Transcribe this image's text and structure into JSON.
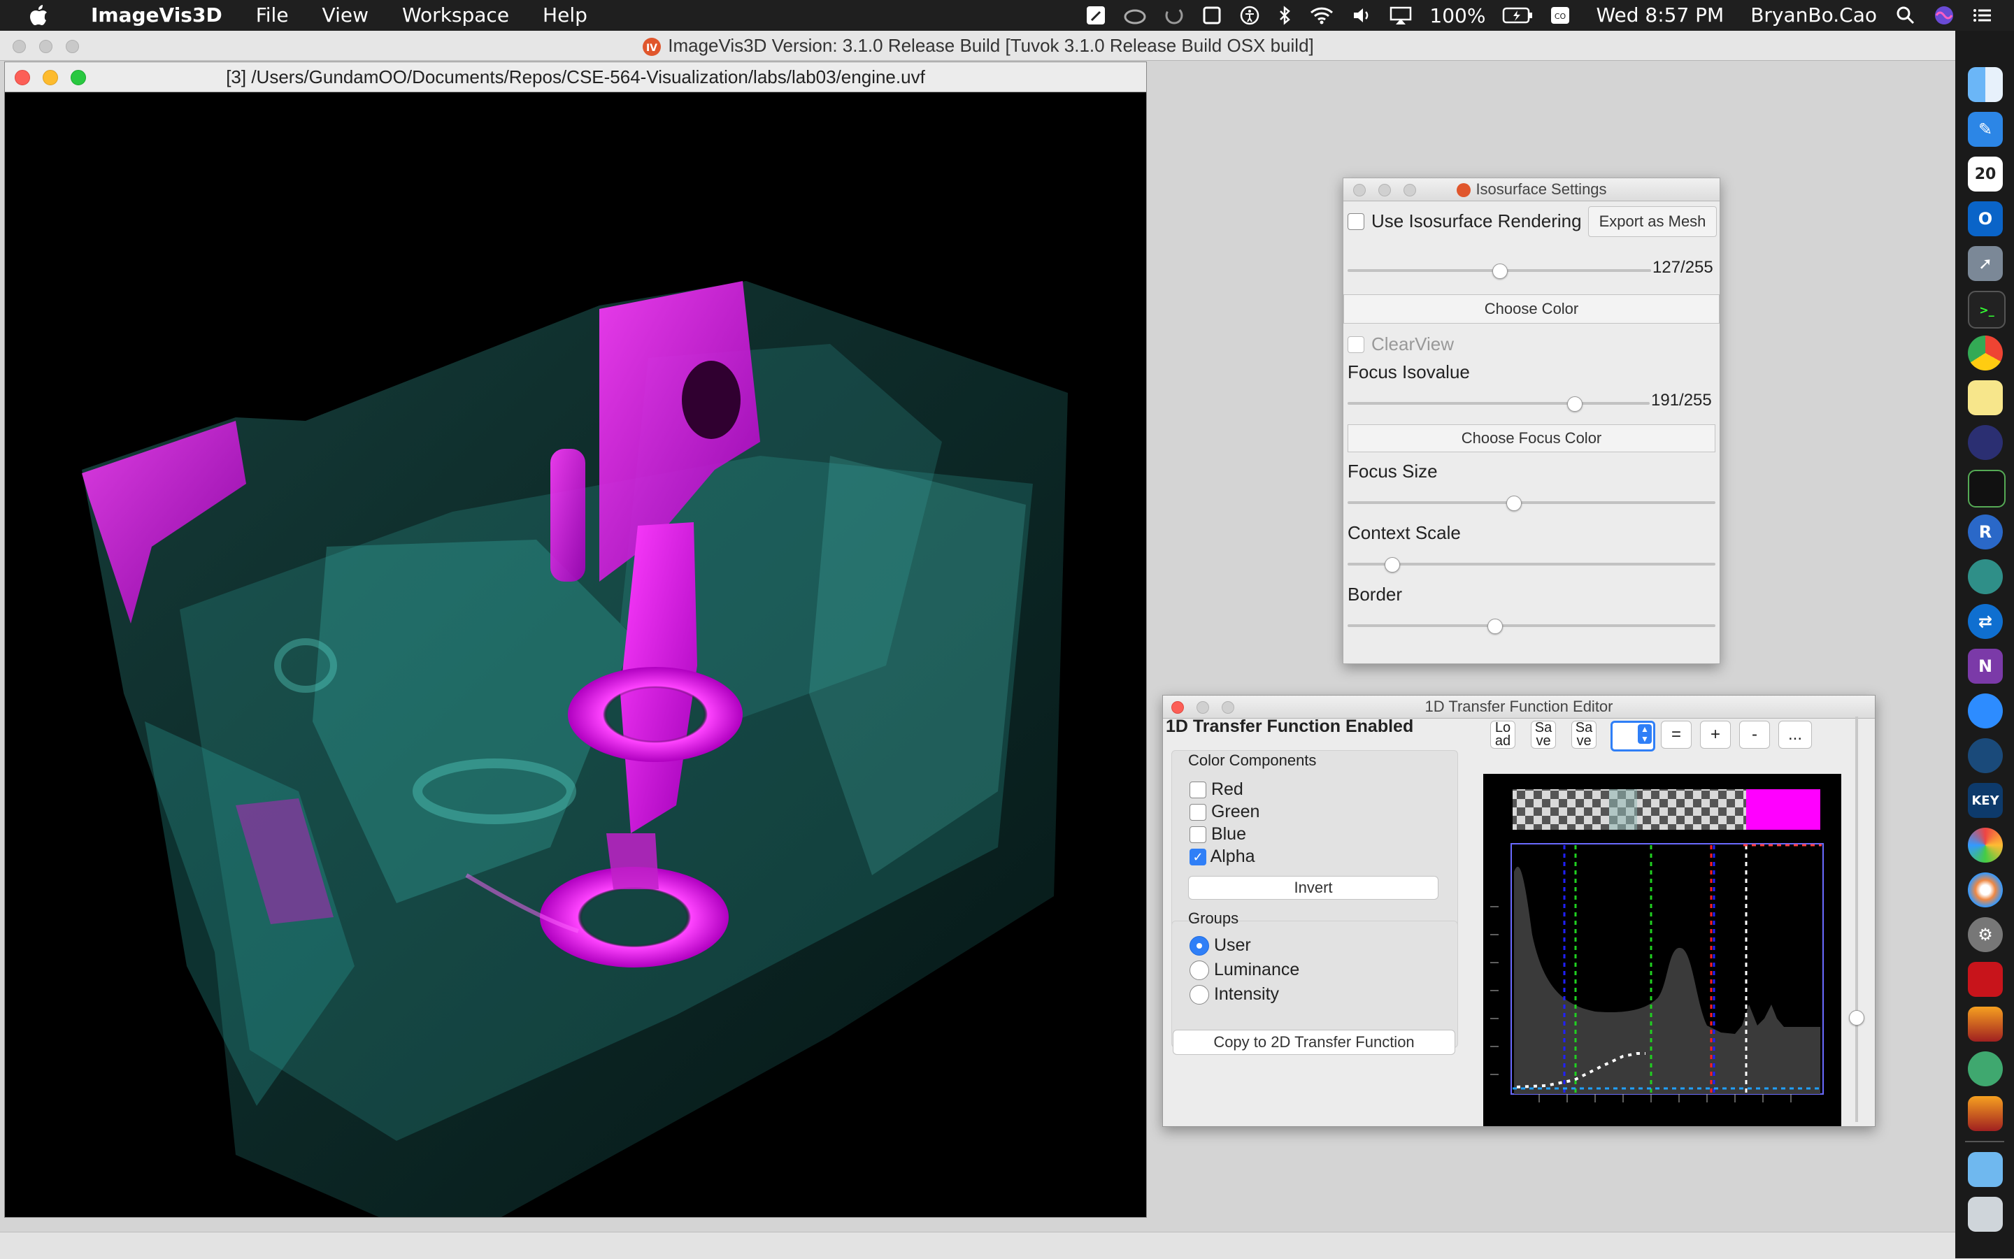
{
  "menubar": {
    "app_name": "ImageVis3D",
    "menus": [
      "File",
      "View",
      "Workspace",
      "Help"
    ],
    "battery": "100%",
    "clock": "Wed 8:57 PM",
    "user": "BryanBo.Cao"
  },
  "main_window": {
    "title": "ImageVis3D Version: 3.1.0 Release Build [Tuvok 3.1.0 Release Build OSX build]"
  },
  "render_window": {
    "title": "[3] /Users/GundamOO/Documents/Repos/CSE-564-Visualization/labs/lab03/engine.uvf"
  },
  "isosurface": {
    "title": "Isosurface Settings",
    "use_label": "Use Isosurface Rendering",
    "export_label": "Export as Mesh",
    "isovalue": "127/255",
    "isovalue_fraction": 0.5,
    "choose_color": "Choose Color",
    "clearview_label": "ClearView",
    "focus_isovalue_label": "Focus Isovalue",
    "focus_isovalue": "191/255",
    "focus_isovalue_fraction": 0.75,
    "choose_focus_color": "Choose Focus Color",
    "focus_size_label": "Focus Size",
    "focus_size_fraction": 0.45,
    "context_scale_label": "Context Scale",
    "context_scale_fraction": 0.12,
    "border_label": "Border",
    "border_fraction": 0.4
  },
  "tf_editor": {
    "title": "1D Transfer Function Editor",
    "status": "1D Transfer Function Enabled",
    "color_components_label": "Color Components",
    "components": [
      {
        "label": "Red",
        "checked": false
      },
      {
        "label": "Green",
        "checked": false
      },
      {
        "label": "Blue",
        "checked": false
      },
      {
        "label": "Alpha",
        "checked": true
      }
    ],
    "invert_label": "Invert",
    "groups_label": "Groups",
    "groups": [
      {
        "label": "User",
        "selected": true
      },
      {
        "label": "Luminance",
        "selected": false
      },
      {
        "label": "Intensity",
        "selected": false
      }
    ],
    "copy_label": "Copy to 2D Transfer Function",
    "toolbar": {
      "load": "Lo ad",
      "save1": "Sa ve",
      "save2": "Sa ve",
      "eq": "=",
      "plus": "+",
      "minus": "-",
      "more": "..."
    }
  },
  "colors": {
    "accent": "#2f7ff7",
    "magenta": "#ff00ff",
    "teal": "#3fb7b0"
  },
  "dock_icons": [
    "finder-icon",
    "pen-icon",
    "calendar-icon",
    "outlook-icon",
    "rocket-icon",
    "terminal-icon",
    "chrome-icon",
    "notes-icon",
    "eclipse-icon",
    "activity-monitor-icon",
    "r-icon",
    "browser-icon",
    "teamviewer-icon",
    "onenote-icon",
    "zoom-icon",
    "search-app-icon",
    "keynote-icon",
    "pinwheel-icon",
    "color-icon",
    "system-preferences-icon",
    "acrobat-icon",
    "imagevis-icon",
    "atom-icon",
    "imagevis-icon-2",
    "folder-icon",
    "trash-icon"
  ],
  "dock": {
    "calendar_day": "20",
    "keynote_label": "KEY"
  }
}
